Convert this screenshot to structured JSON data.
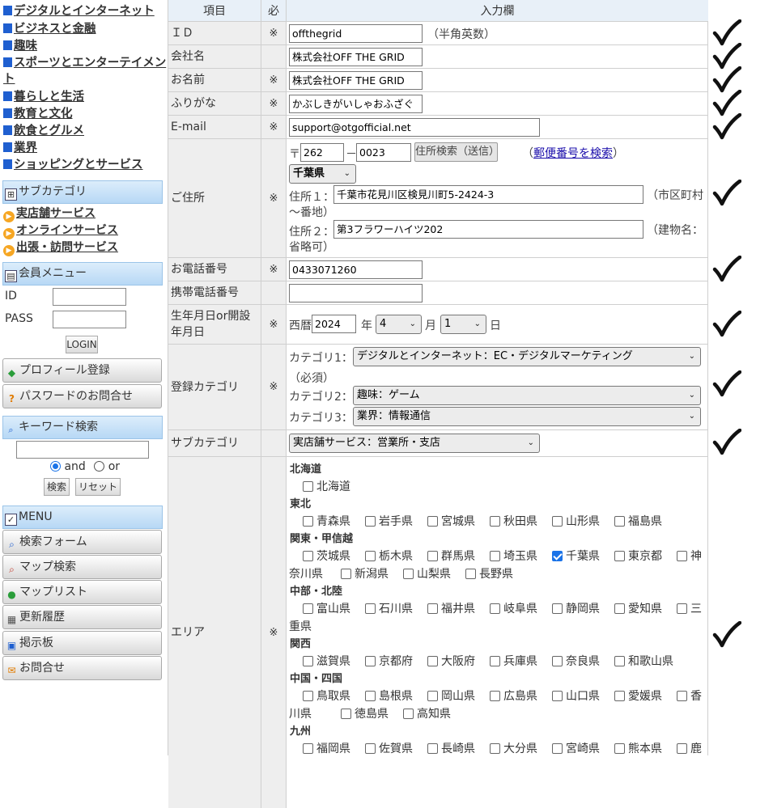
{
  "sidebar": {
    "categories": [
      "デジタルとインターネット",
      "ビジネスと金融",
      "趣味",
      "スポーツとエンターテイメン",
      "ト",
      "暮らしと生活",
      "教育と文化",
      "飲食とグルメ",
      "業界",
      "ショッピングとサービス"
    ],
    "subcategory_header": "サブカテゴリ",
    "subcategories": [
      "実店舗サービス",
      "オンラインサービス",
      "出張・訪問サービス"
    ],
    "member_header": "会員メニュー",
    "id_label": "ID",
    "pass_label": "PASS",
    "login_button": "LOGIN",
    "profile_button": "プロフィール登録",
    "password_button": "パスワードのお問合せ",
    "keyword_header": "キーワード検索",
    "and_label": "and",
    "or_label": "or",
    "search_button": "検索",
    "reset_button": "リセット",
    "menu_header": "MENU",
    "menu_items": [
      "検索フォーム",
      "マップ検索",
      "マップリスト",
      "更新履歴",
      "掲示板",
      "お問合せ"
    ]
  },
  "form": {
    "header": {
      "item": "項目",
      "required": "必",
      "input": "入力欄"
    },
    "req_mark": "※",
    "id": {
      "label": "ＩＤ",
      "value": "offthegrid",
      "note": "（半角英数）"
    },
    "company": {
      "label": "会社名",
      "value": "株式会社OFF THE GRID"
    },
    "name": {
      "label": "お名前",
      "value": "株式会社OFF THE GRID"
    },
    "furigana": {
      "label": "ふりがな",
      "value": "かぶしきがいしゃおふざぐ"
    },
    "email": {
      "label": "E-mail",
      "value": "support@otgofficial.net"
    },
    "address": {
      "label": "ご住所",
      "postal_mark": "〒",
      "zip1": "262",
      "dash": "－",
      "zip2": "0023",
      "search_button": "住所検索（送信）",
      "postal_link_open": "（",
      "postal_link": "郵便番号を検索",
      "postal_link_close": "）",
      "prefecture": "千葉県",
      "addr1_label": "住所１：",
      "addr1_value": "千葉市花見川区検見川町5-2424-3",
      "addr1_note_a": "（市区町村",
      "addr1_note_b": "～番地）",
      "addr2_label": "住所２：",
      "addr2_value": "第3フラワーハイツ202",
      "addr2_note_a": "（建物名：",
      "addr2_note_b": "省略可）"
    },
    "phone": {
      "label": "お電話番号",
      "value": "0433071260"
    },
    "mobile": {
      "label": "携帯電話番号",
      "value": ""
    },
    "birth": {
      "label_a": "生年月日or開設",
      "label_b": "年月日",
      "era": "西暦",
      "year": "2024",
      "year_unit": "年",
      "month": "4",
      "month_unit": "月",
      "day": "1",
      "day_unit": "日"
    },
    "category": {
      "label": "登録カテゴリ",
      "cat1_label": "カテゴリ1：",
      "cat1_value": "デジタルとインターネット：EC・デジタルマーケティング",
      "required_note": "（必須）",
      "cat2_label": "カテゴリ2：",
      "cat2_value": "趣味：ゲーム",
      "cat3_label": "カテゴリ3：",
      "cat3_value": "業界：情報通信"
    },
    "subcategory": {
      "label": "サブカテゴリ",
      "value": "実店舗サービス：営業所・支店"
    },
    "area": {
      "label": "エリア",
      "regions": [
        {
          "name": "北海道",
          "lines": [
            [
              "北海道"
            ]
          ]
        },
        {
          "name": "東北",
          "lines": [
            [
              "青森県",
              "岩手県",
              "宮城県",
              "秋田県",
              "山形県",
              "福島県"
            ]
          ]
        },
        {
          "name": "関東・甲信越",
          "lines": [
            [
              "茨城県",
              "栃木県",
              "群馬県",
              "埼玉県",
              "千葉県",
              "東京都",
              "神"
            ],
            [
              "奈川県",
              "新潟県",
              "山梨県",
              "長野県"
            ]
          ]
        },
        {
          "name": "中部・北陸",
          "lines": [
            [
              "富山県",
              "石川県",
              "福井県",
              "岐阜県",
              "静岡県",
              "愛知県",
              "三"
            ],
            [
              "重県"
            ]
          ]
        },
        {
          "name": "関西",
          "lines": [
            [
              "滋賀県",
              "京都府",
              "大阪府",
              "兵庫県",
              "奈良県",
              "和歌山県"
            ]
          ]
        },
        {
          "name": "中国・四国",
          "lines": [
            [
              "鳥取県",
              "島根県",
              "岡山県",
              "広島県",
              "山口県",
              "愛媛県",
              "香"
            ],
            [
              "川県",
              "徳島県",
              "高知県"
            ]
          ]
        },
        {
          "name": "九州",
          "lines": [
            [
              "福岡県",
              "佐賀県",
              "長崎県",
              "大分県",
              "宮崎県",
              "熊本県",
              "鹿"
            ]
          ]
        }
      ],
      "checked": [
        "千葉県"
      ]
    }
  },
  "colors": {
    "accent": "#1f5fd0",
    "check_blue": "#1a73e8",
    "label_bg": "#eeeeee",
    "header_bg": "#e8f0f8",
    "tick": "#111111"
  },
  "icons": [
    "square-bullet-icon",
    "tree-icon",
    "arrow-circle-icon",
    "member-card-icon",
    "leaf-icon",
    "question-icon",
    "search-icon",
    "checkbox-icon",
    "map-search-icon",
    "pin-icon",
    "list-icon",
    "board-icon",
    "mail-icon",
    "handwritten-check-icon"
  ]
}
